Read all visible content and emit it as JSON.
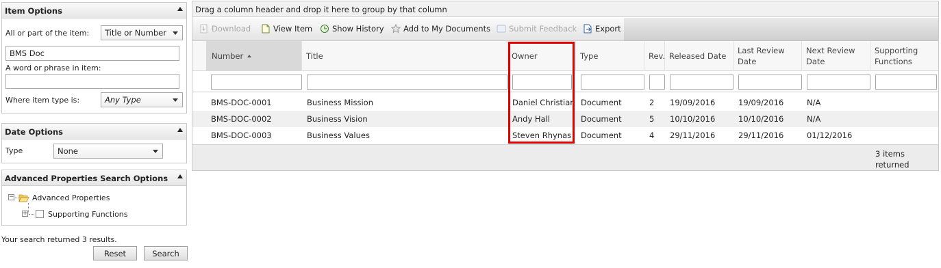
{
  "item_options": {
    "title": "Item Options",
    "all_or_part_label": "All or part of the item:",
    "match_select": "Title or Number",
    "search_value": "BMS Doc",
    "phrase_label": "A word or phrase in item:",
    "phrase_value": "",
    "type_label": "Where item type is:",
    "type_select": "Any Type"
  },
  "date_options": {
    "title": "Date Options",
    "type_label": "Type",
    "type_select": "None"
  },
  "advanced": {
    "title": "Advanced Properties Search Options",
    "root_label": "Advanced Properties",
    "child_label": "Supporting Functions"
  },
  "search_summary": "Your search returned 3 results.",
  "buttons": {
    "reset": "Reset",
    "search": "Search"
  },
  "grid": {
    "group_hint": "Drag a column header and drop it here to group by that column",
    "toolbar": {
      "download": "Download",
      "view_item": "View Item",
      "show_history": "Show History",
      "add_to_docs": "Add to My Documents",
      "submit_feedback": "Submit Feedback",
      "export": "Export"
    },
    "columns": {
      "number": "Number",
      "title": "Title",
      "owner": "Owner",
      "type": "Type",
      "rev": "Rev.",
      "released": "Released Date",
      "last_review": "Last Review Date",
      "next_review": "Next Review Date",
      "supporting": "Supporting Functions"
    },
    "rows": [
      {
        "number": "BMS-DOC-0001",
        "title": "Business Mission",
        "owner": "Daniel Christian",
        "type": "Document",
        "rev": "2",
        "released": "19/09/2016",
        "last_review": "19/09/2016",
        "next_review": "N/A",
        "supporting": ""
      },
      {
        "number": "BMS-DOC-0002",
        "title": "Business Vision",
        "owner": "Andy Hall",
        "type": "Document",
        "rev": "5",
        "released": "10/10/2016",
        "last_review": "10/10/2016",
        "next_review": "N/A",
        "supporting": ""
      },
      {
        "number": "BMS-DOC-0003",
        "title": "Business Values",
        "owner": "Steven Rhynas",
        "type": "Document",
        "rev": "4",
        "released": "29/11/2016",
        "last_review": "29/11/2016",
        "next_review": "01/12/2016",
        "supporting": ""
      }
    ],
    "footer_text": "3 items returned"
  },
  "colors": {
    "highlight": "#e00000",
    "sorted_header": "#d9d9d9"
  }
}
